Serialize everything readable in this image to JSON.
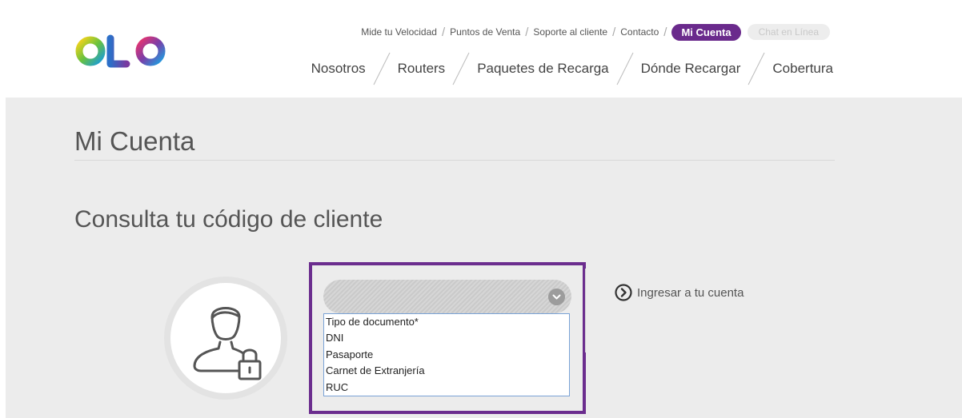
{
  "header": {
    "logo_text": "OLO",
    "top_links": [
      {
        "id": "velocidad",
        "label": "Mide tu Velocidad"
      },
      {
        "id": "puntos",
        "label": "Puntos de Venta"
      },
      {
        "id": "soporte",
        "label": "Soporte al cliente"
      },
      {
        "id": "contacto",
        "label": "Contacto"
      }
    ],
    "account_button": "Mi Cuenta",
    "chat_button": "Chat en Línea",
    "main_nav": [
      {
        "id": "nosotros",
        "label": "Nosotros"
      },
      {
        "id": "routers",
        "label": "Routers"
      },
      {
        "id": "paquetes",
        "label": "Paquetes de Recarga"
      },
      {
        "id": "donde",
        "label": "Dónde Recargar"
      },
      {
        "id": "cobertura",
        "label": "Cobertura"
      }
    ]
  },
  "main": {
    "page_title": "Mi Cuenta",
    "section_title": "Consulta tu código de cliente",
    "document_select": {
      "options": [
        "Tipo de documento*",
        "DNI",
        "Pasaporte",
        "Carnet de Extranjería",
        "RUC"
      ]
    },
    "login_link": "Ingresar a tu cuenta"
  },
  "colors": {
    "brand_purple": "#6a2a8c",
    "content_bg": "#ececec",
    "focus_blue": "#7aa3d6"
  },
  "icons": [
    "olo-logo",
    "user-lock-icon",
    "chevron-down-icon",
    "arrow-circle-right-icon"
  ]
}
